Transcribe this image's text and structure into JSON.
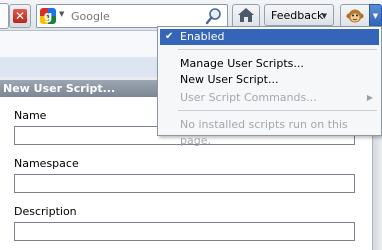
{
  "toolbar": {
    "stop_icon": "x-icon",
    "search": {
      "placeholder": "Google",
      "engine_icon": "google-icon",
      "go_icon": "magnifier-icon"
    },
    "home_icon": "home-icon",
    "feedback_label": "Feedback",
    "greasemonkey_icon": "monkey-icon"
  },
  "menu": {
    "items": [
      {
        "label": "Enabled",
        "checked": true
      },
      {
        "label": "Manage User Scripts..."
      },
      {
        "label": "New User Script..."
      },
      {
        "label": "User Script Commands...",
        "disabled": true,
        "has_submenu": true
      },
      {
        "label": "No installed scripts run on this page.",
        "disabled": true
      }
    ]
  },
  "form": {
    "title": "New User Script...",
    "fields": [
      {
        "label": "Name",
        "value": ""
      },
      {
        "label": "Namespace",
        "value": ""
      },
      {
        "label": "Description",
        "value": ""
      }
    ]
  },
  "colors": {
    "menu_highlight": "#3465b8",
    "form_title_bg": "#8893a0"
  }
}
